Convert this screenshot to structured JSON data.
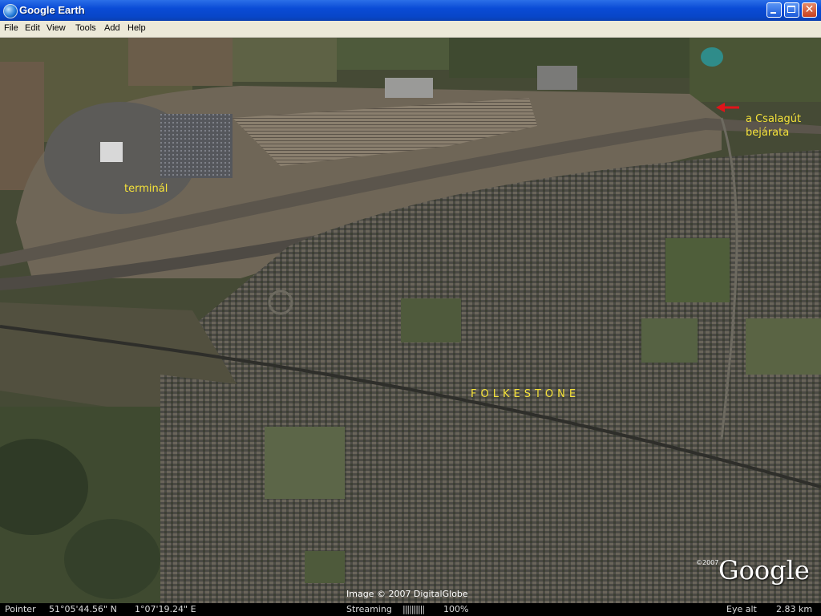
{
  "window": {
    "title": "Google Earth",
    "close_glyph": "✕"
  },
  "menu": [
    "File",
    "Edit",
    "View",
    "Tools",
    "Add",
    "Help"
  ],
  "map": {
    "labels": {
      "terminal": "terminál",
      "tunnel_line1": "a Csalagút",
      "tunnel_line2": "bejárata",
      "town": "FOLKESTONE"
    },
    "arrow_color": "#e0141a",
    "label_color": "#f5e23a"
  },
  "overlay": {
    "copyright": "Image © 2007 DigitalGlobe",
    "logo_year": "©2007",
    "logo": "Google"
  },
  "status": {
    "pointer_label": "Pointer",
    "latitude": "51°05'44.56\" N",
    "longitude": "1°07'19.24\" E",
    "streaming_label": "Streaming",
    "streaming_bars": "||||||||||",
    "streaming_percent": "100%",
    "eye_alt_label": "Eye alt",
    "eye_alt_value": "2.83 km"
  }
}
